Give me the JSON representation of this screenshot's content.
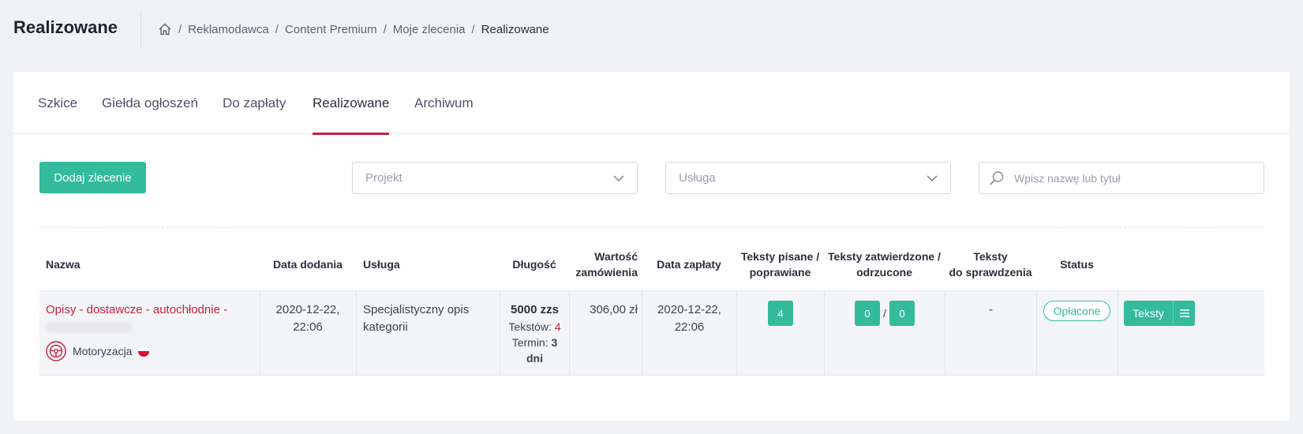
{
  "header": {
    "title": "Realizowane",
    "breadcrumb": [
      "Reklamodawca",
      "Content Premium",
      "Moje zlecenia"
    ],
    "breadcrumb_current": "Realizowane"
  },
  "tabs": [
    {
      "label": "Szkice"
    },
    {
      "label": "Giełda ogłoszeń"
    },
    {
      "label": "Do zapłaty"
    },
    {
      "label": "Realizowane",
      "active": true
    },
    {
      "label": "Archiwum"
    }
  ],
  "toolbar": {
    "add_label": "Dodaj zlecenie",
    "project_placeholder": "Projekt",
    "service_placeholder": "Usługa",
    "search_placeholder": "Wpisz nazwę lub tytuł"
  },
  "table": {
    "headers": {
      "name": "Nazwa",
      "date_added": "Data dodania",
      "service": "Usługa",
      "length": "Długość",
      "value_1": "Wartość",
      "value_2": "zamówienia",
      "payment_date": "Data zapłaty",
      "written_1": "Teksty pisane /",
      "written_2": "poprawiane",
      "approved_1": "Teksty zatwierdzone /",
      "approved_2": "odrzucone",
      "review_1": "Teksty",
      "review_2": "do sprawdzenia",
      "status": "Status"
    },
    "rows": [
      {
        "name": "Opisy - dostawcze - autochłodnie -",
        "category": "Motoryzacja",
        "date_added_1": "2020-12-22,",
        "date_added_2": "22:06",
        "service_1": "Specjalistyczny opis",
        "service_2": "kategorii",
        "length_main": "5000 zzs",
        "texts_label": "Tekstów: ",
        "texts_count": "4",
        "term_label": "Termin: ",
        "term_value": "3",
        "term_unit": "dni",
        "value": "306,00 zł",
        "payment_date_1": "2020-12-22,",
        "payment_date_2": "22:06",
        "written": "4",
        "approved": "0",
        "slash": "/",
        "rejected": "0",
        "to_review": "-",
        "status": "Opłacone",
        "texts_button": "Teksty"
      }
    ]
  },
  "colors": {
    "accent": "#33bb9c",
    "active_tab": "#c8203f",
    "link": "#c8203f"
  },
  "icons": [
    "home-icon",
    "chevron-down-icon",
    "search-icon",
    "steering-wheel-icon",
    "poland-flag-icon",
    "hamburger-menu-icon"
  ]
}
